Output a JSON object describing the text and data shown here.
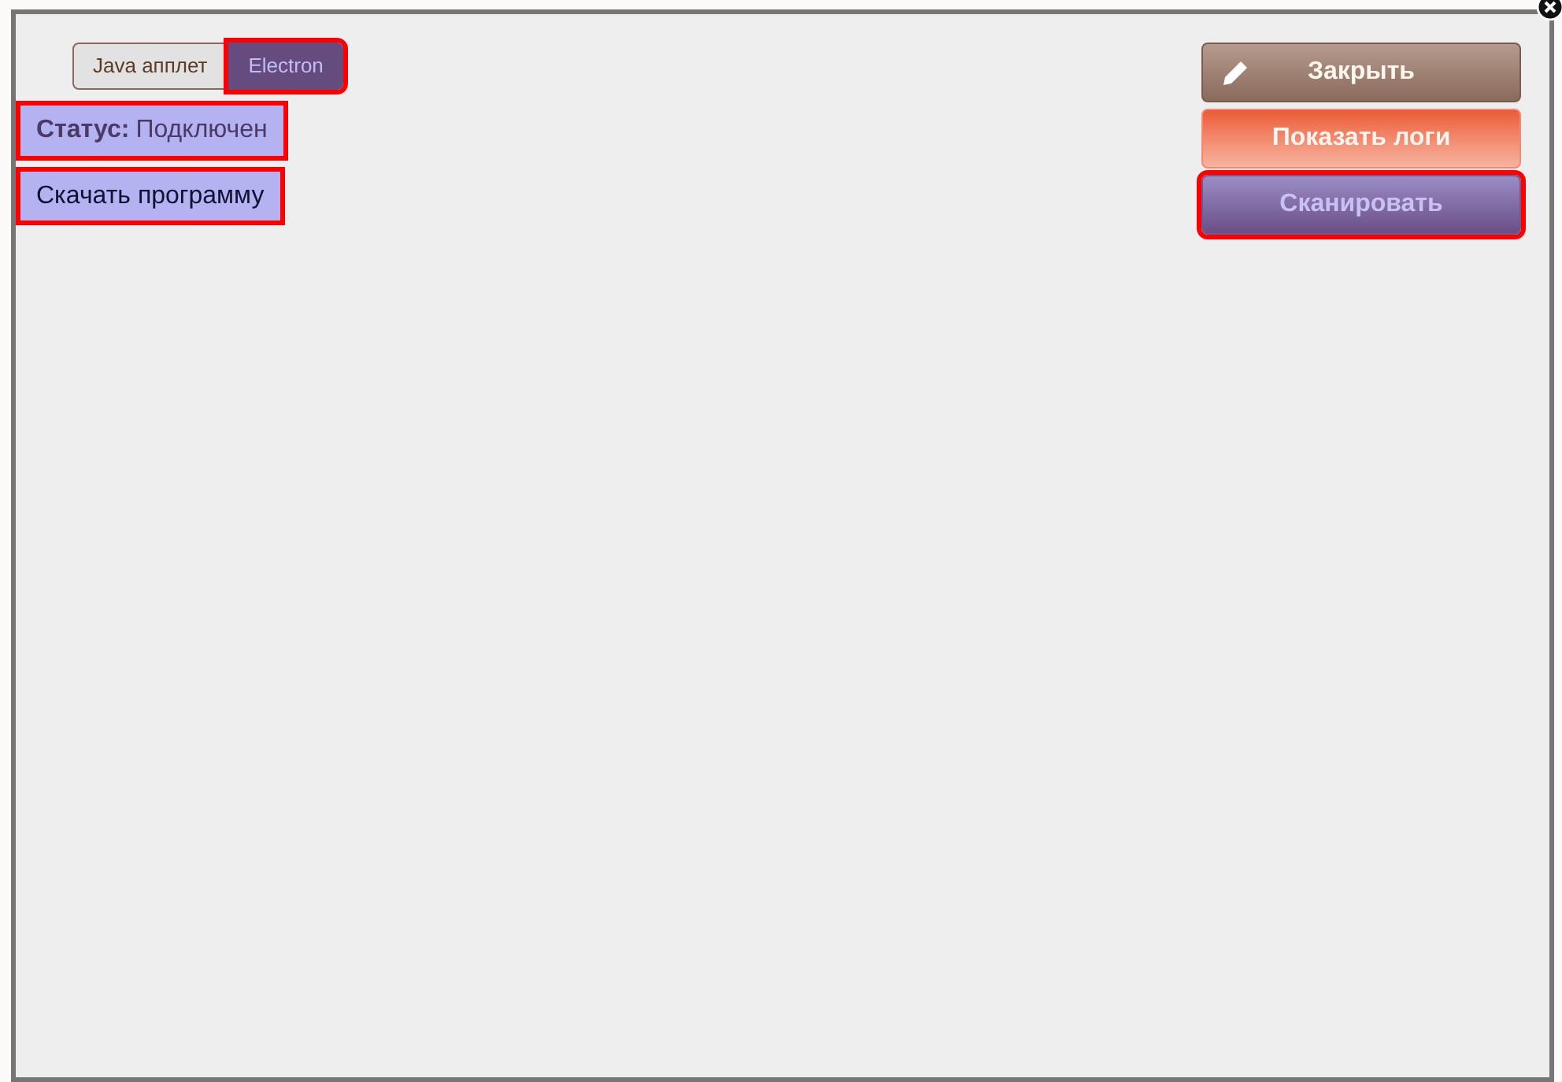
{
  "mode_tabs": [
    {
      "label": "Java апплет",
      "selected": false,
      "highlighted": false
    },
    {
      "label": "Electron",
      "selected": true,
      "highlighted": true
    }
  ],
  "status": {
    "label": "Статус:",
    "value": "Подключен",
    "highlighted": true
  },
  "download": {
    "label": "Скачать программу",
    "highlighted": true
  },
  "buttons": [
    {
      "kind": "close",
      "label": "Закрыть",
      "highlighted": false
    },
    {
      "kind": "logs",
      "label": "Показать логи",
      "highlighted": false
    },
    {
      "kind": "scan",
      "label": "Сканировать",
      "highlighted": true
    }
  ]
}
